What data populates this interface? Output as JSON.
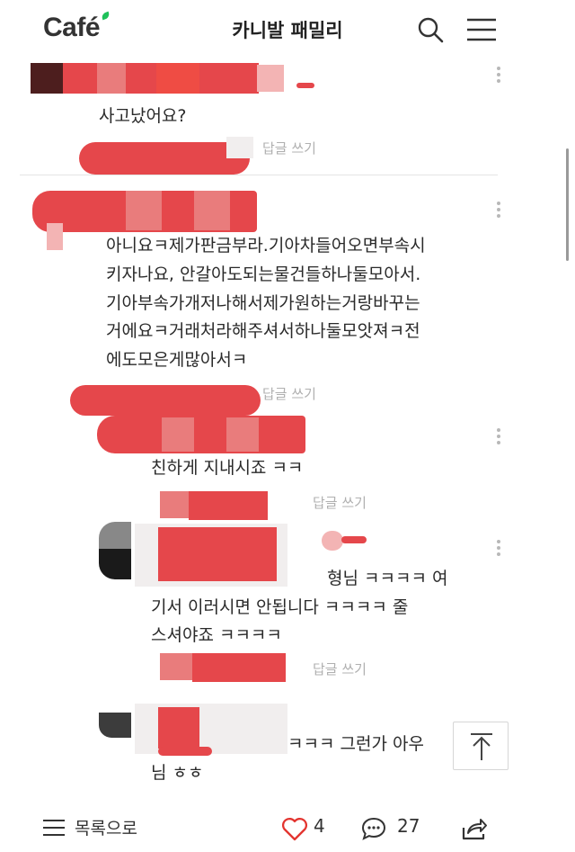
{
  "header": {
    "logo": "Café",
    "title": "카니발 패밀리"
  },
  "comments": [
    {
      "text": "사고났어요?",
      "reply": "답글 쓰기"
    },
    {
      "lines": [
        "아니요ㅋ제가판금부라.기아차들어오면부속시",
        "키자나요, 안갈아도되는물건들하나둘모아서.",
        "기아부속가개저나해서제가원하는거랑바꾸는",
        "거에요ㅋ거래처라해주셔서하나둘모앗져ㅋ전",
        "에도모은게많아서ㅋ"
      ],
      "reply": "답글 쓰기"
    },
    {
      "text": "친하게 지내시죠 ㅋㅋ",
      "reply": "답글 쓰기"
    },
    {
      "lines": [
        "형님 ㅋㅋㅋㅋ 여",
        "기서 이러시면 안됩니다 ㅋㅋㅋㅋ 줄",
        "스셔야죠 ㅋㅋㅋㅋ"
      ],
      "reply": "답글 쓰기"
    },
    {
      "lines": [
        "ㅋㅋㅋ 그런가 아우",
        "님 ㅎㅎ"
      ]
    }
  ],
  "bottom_bar": {
    "list_label": "목록으로",
    "like_count": "4",
    "comment_count": "27"
  },
  "icons": {
    "like": "heart-icon",
    "comment": "speech-bubble-icon",
    "share": "share-icon",
    "search": "search-icon",
    "menu": "hamburger-menu-icon",
    "scroll_top": "arrow-up-icon"
  },
  "colors": {
    "redaction": "#e5474b",
    "logo_leaf": "#1fc15a"
  }
}
